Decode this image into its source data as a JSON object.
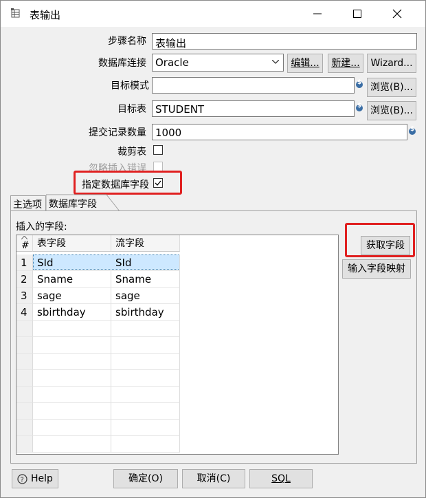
{
  "window": {
    "title": "表输出"
  },
  "form": {
    "step_name_label": "步骤名称",
    "step_name_value": "表输出",
    "db_conn_label": "数据库连接",
    "db_conn_value": "Oracle",
    "edit_btn": "编辑...",
    "new_btn": "新建...",
    "wizard_btn": "Wizard...",
    "target_schema_label": "目标模式",
    "target_schema_value": "",
    "browse_btn_1": "浏览(B)...",
    "target_table_label": "目标表",
    "target_table_value": "STUDENT",
    "browse_btn_2": "浏览(B)...",
    "commit_size_label": "提交记录数量",
    "commit_size_value": "1000",
    "truncate_label": "裁剪表",
    "truncate_checked": false,
    "ignore_errors_label": "忽略插入错误",
    "specify_fields_label": "指定数据库字段",
    "specify_fields_checked": true
  },
  "tabs": [
    {
      "label": "主选项"
    },
    {
      "label": "数据库字段"
    }
  ],
  "fields_panel": {
    "group_label": "插入的字段:",
    "columns": [
      "#",
      "表字段",
      "流字段"
    ],
    "rows": [
      {
        "num": "1",
        "table_field": "SId",
        "stream_field": "SId"
      },
      {
        "num": "2",
        "table_field": "Sname",
        "stream_field": "Sname"
      },
      {
        "num": "3",
        "table_field": "sage",
        "stream_field": "sage"
      },
      {
        "num": "4",
        "table_field": "sbirthday",
        "stream_field": "sbirthday"
      }
    ],
    "get_fields_btn": "获取字段",
    "map_fields_btn": "输入字段映射"
  },
  "footer": {
    "help_btn": "Help",
    "ok_btn": "确定(O)",
    "cancel_btn": "取消(C)",
    "sql_btn": "SQL"
  },
  "colors": {
    "highlight": "#e02020",
    "selection": "#cde8ff"
  }
}
